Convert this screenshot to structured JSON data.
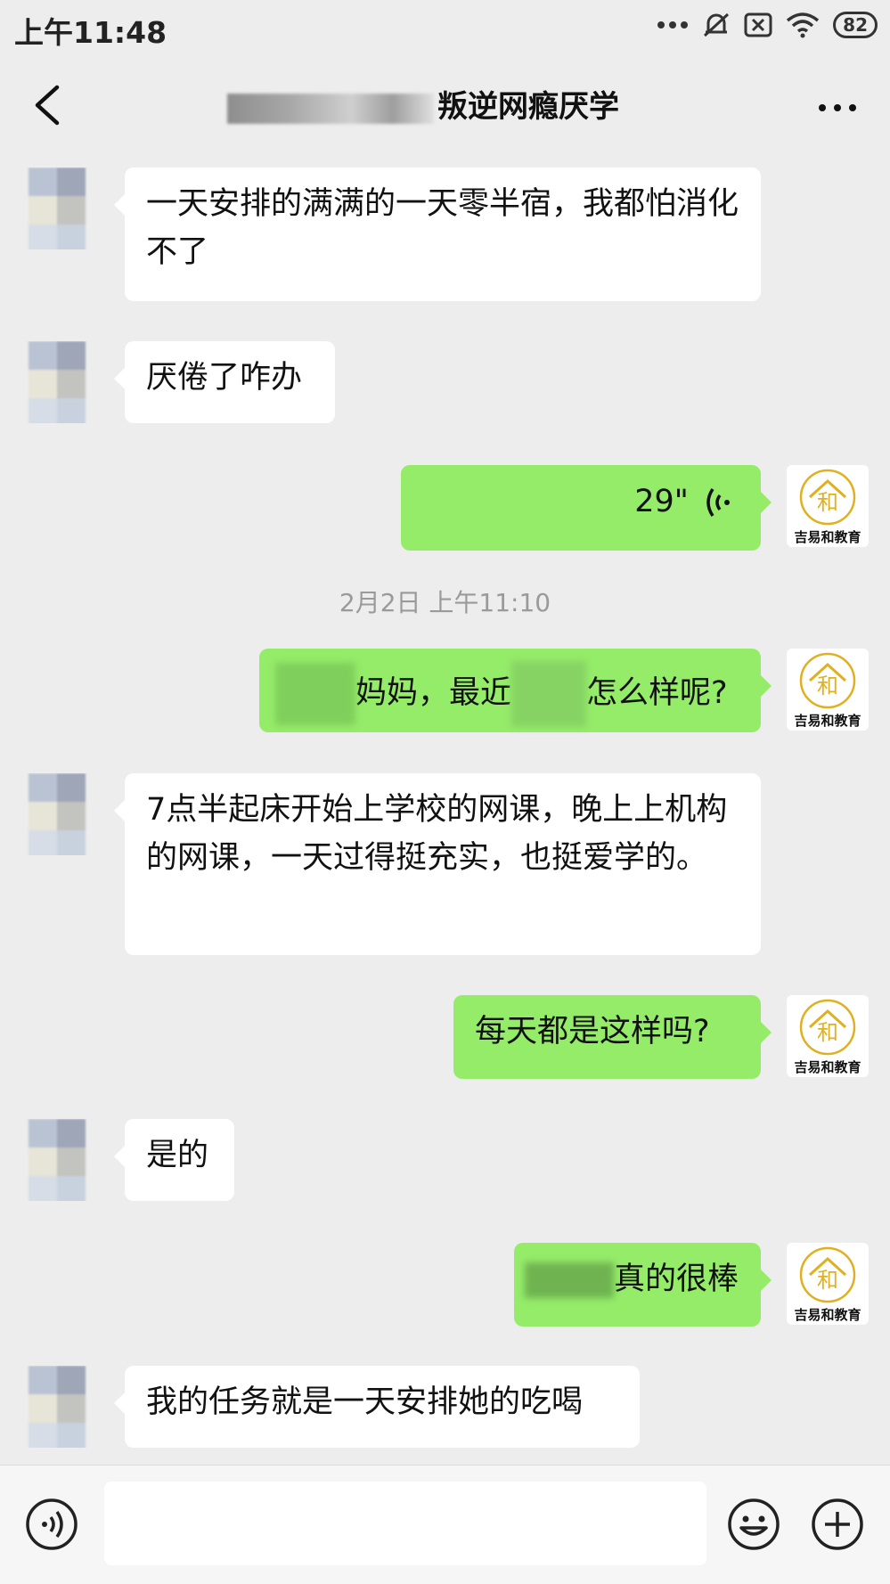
{
  "status": {
    "time": "上午11:48",
    "battery": "82",
    "icons": [
      "more-dots-icon",
      "mute-icon",
      "sim-off-icon",
      "wifi-icon",
      "battery-icon"
    ]
  },
  "header": {
    "title_visible": "叛逆网瘾厌学",
    "icons": [
      "back-arrow-icon",
      "more-options-icon"
    ]
  },
  "brand": {
    "logo_text": "吉易和教育",
    "logo_glyph": "和",
    "accent": "#95ec69"
  },
  "messages": [
    {
      "side": "left",
      "text": "一天安排的满满的一天零半宿，我都怕消化不了"
    },
    {
      "side": "left",
      "text": "厌倦了咋办"
    },
    {
      "side": "right",
      "voice_duration": "29\""
    },
    {
      "timestamp": "2月2日 上午11:10"
    },
    {
      "side": "right",
      "parts": [
        "妈妈，最近",
        "怎么样呢?"
      ]
    },
    {
      "side": "left",
      "text": "7点半起床开始上学校的网课，晚上上机构的网课，一天过得挺充实，也挺爱学的。"
    },
    {
      "side": "right",
      "text": "每天都是这样吗?"
    },
    {
      "side": "left",
      "text": "是的"
    },
    {
      "side": "right",
      "text": "真的很棒"
    },
    {
      "side": "left",
      "text": "我的任务就是一天安排她的吃喝"
    }
  ],
  "inputbar": {
    "placeholder": "",
    "icons": [
      "voice-input-icon",
      "emoji-icon",
      "add-icon"
    ]
  }
}
